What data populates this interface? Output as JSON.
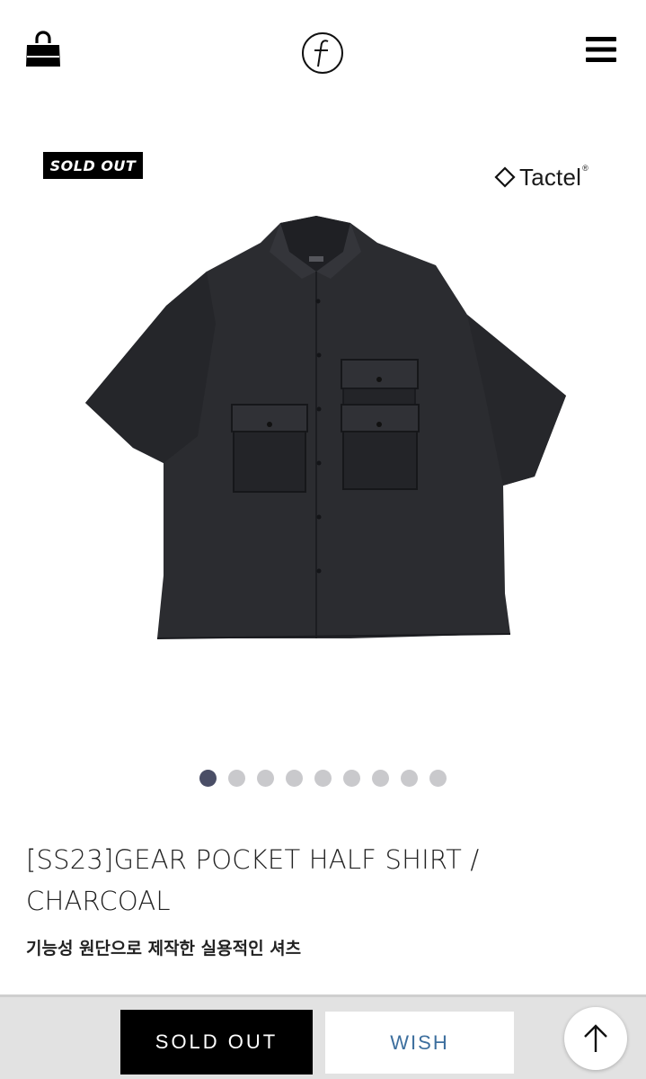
{
  "header": {
    "bag_icon": "shopping-bag-icon",
    "logo_icon": "brand-logo-f",
    "menu_icon": "hamburger-menu-icon"
  },
  "gallery": {
    "badge": "SOLD OUT",
    "fabric_brand": "Tactel",
    "fabric_brand_mark": "®",
    "dots_total": 9,
    "active_dot": 1
  },
  "product": {
    "title": "[SS23]GEAR POCKET HALF SHIRT / CHARCOAL",
    "subtitle": "기능성 원단으로 제작한 실용적인 셔츠"
  },
  "bottom_bar": {
    "sold_out_label": "SOLD OUT",
    "wish_label": "WISH",
    "scroll_top_icon": "arrow-up-icon"
  },
  "colors": {
    "wish_text": "#3d6f9e",
    "active_dot": "#4a4e66",
    "inactive_dot": "#c9c9cc",
    "shirt": "#2b2c30"
  }
}
